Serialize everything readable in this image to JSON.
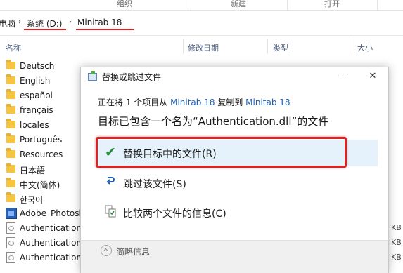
{
  "ribbon": {
    "groups": [
      "组织",
      "新建",
      "打开"
    ]
  },
  "address": {
    "crumb0": "电脑",
    "crumb1": "系统 (D:)",
    "crumb2": "Minitab 18"
  },
  "columns": {
    "name": "名称",
    "modified": "修改日期",
    "type": "类型",
    "size": "大小"
  },
  "files": [
    {
      "name": "Deutsch",
      "kind": "folder"
    },
    {
      "name": "English",
      "kind": "folder"
    },
    {
      "name": "español",
      "kind": "folder"
    },
    {
      "name": "français",
      "kind": "folder"
    },
    {
      "name": "locales",
      "kind": "folder"
    },
    {
      "name": "Português",
      "kind": "folder"
    },
    {
      "name": "Resources",
      "kind": "folder"
    },
    {
      "name": "日本語",
      "kind": "folder"
    },
    {
      "name": "中文(简体)",
      "kind": "folder"
    },
    {
      "name": "한국어",
      "kind": "folder"
    },
    {
      "name": "Adobe_Photosh",
      "kind": "exe"
    },
    {
      "name": "Authentication.",
      "kind": "file",
      "size_fragment": "KB"
    },
    {
      "name": "AuthenticationC",
      "kind": "file",
      "size_fragment": "KB"
    },
    {
      "name": "AuthenticationD",
      "kind": "file",
      "size_fragment": "KB"
    }
  ],
  "dialog": {
    "title": "替换或跳过文件",
    "progress_prefix": "正在将 1 个项目从",
    "progress_source": "Minitab 18",
    "progress_mid": "复制到",
    "progress_dest": "Minitab 18",
    "question": "目标已包含一个名为“Authentication.dll”的文件",
    "option_replace": "替换目标中的文件(R)",
    "option_skip": "跳过该文件(S)",
    "option_compare": "比较两个文件的信息(C)",
    "details_label": "简略信息",
    "minimize_glyph": "—",
    "close_glyph": "✕"
  },
  "icons": {
    "replace": "check-icon",
    "skip": "skip-arrow-icon",
    "compare": "compare-files-icon",
    "details": "chevron-up-icon"
  },
  "colors": {
    "accent": "#1e5fb3",
    "annotation_red": "#dd2222",
    "check_green": "#2b8a3e"
  }
}
